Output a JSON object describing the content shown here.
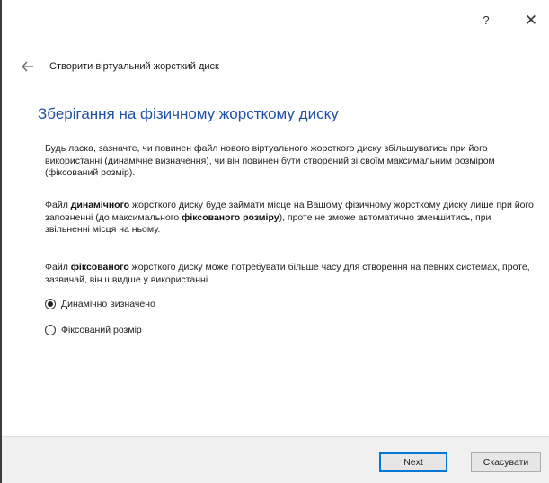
{
  "title_bar": {
    "help_label": "?",
    "close_label": "✕"
  },
  "header": {
    "back_icon": "back-arrow-icon",
    "title": "Створити віртуальний жорсткий диск"
  },
  "main": {
    "heading": "Зберігання на фізичному жорсткому диску",
    "paragraph1": "Будь ласка, зазначте, чи повинен файл нового віртуального жорсткого диску збільшуватись при його використанні (динамічне визначення), чи він повинен бути створений зі своїм максимальним розміром (фіксований розмір).",
    "paragraph2": {
      "t1": "Файл ",
      "b1": "динамічного",
      "t2": " жорсткого диску буде займати місце на Вашому фізичному жорсткому диску лише при його заповненні (до максимального ",
      "b2": "фіксованого розміру",
      "t3": "), проте не зможе автоматично зменшитись, при звільненні місця на ньому."
    },
    "paragraph3": {
      "t1": "Файл ",
      "b1": "фіксованого",
      "t2": " жорсткого диску може потребувати більше часу для створення на певних системах, проте, зазвичай, він швидше у використанні."
    },
    "options": [
      {
        "label": "Динамічно визначено",
        "selected": true
      },
      {
        "label": "Фіксований розмір",
        "selected": false
      }
    ]
  },
  "footer": {
    "next_label": "Next",
    "cancel_label": "Скасувати"
  },
  "colors": {
    "heading": "#1e50a8",
    "default_button_border": "#0078d7",
    "footer_bg": "#f0f0f0"
  }
}
